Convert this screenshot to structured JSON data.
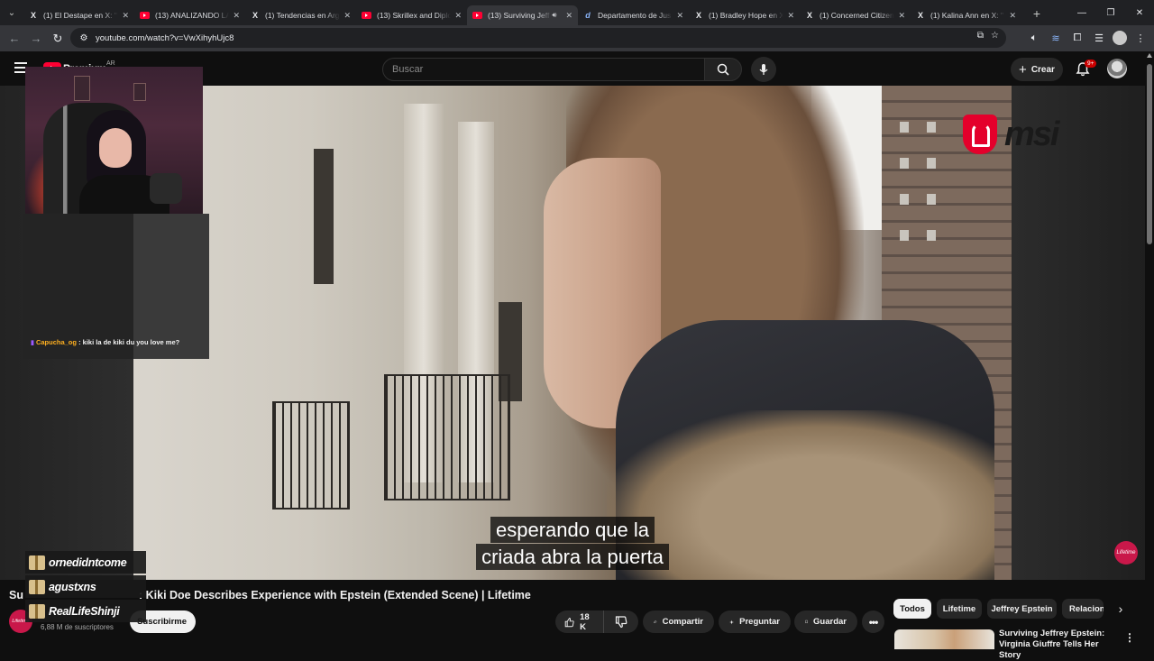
{
  "browser": {
    "tabs": [
      {
        "title": "(1) El Destape en X: \"",
        "favicon": "x-logo"
      },
      {
        "title": "(13) ANALIZANDO LA",
        "favicon": "youtube-logo"
      },
      {
        "title": "(1) Tendencias en Arg",
        "favicon": "x-logo"
      },
      {
        "title": "(13) Skrillex and Diplo",
        "favicon": "youtube-logo"
      },
      {
        "title": "(13) Surviving Jeff",
        "favicon": "youtube-logo",
        "active": true
      },
      {
        "title": "Departamento de Jus",
        "favicon": "doj-logo"
      },
      {
        "title": "(1) Bradley Hope en X",
        "favicon": "x-logo"
      },
      {
        "title": "(1) Concerned Citizen",
        "favicon": "x-logo"
      },
      {
        "title": "(1) Kalina Ann en X: \"",
        "favicon": "x-logo"
      }
    ],
    "url": "youtube.com/watch?v=VwXihyhUjc8"
  },
  "youtube": {
    "logo_text": "Premium",
    "country": "AR",
    "search_placeholder": "Buscar",
    "create_label": "Crear",
    "notifications_badge": "9+"
  },
  "stream_overlay": {
    "chat_user": "Capucha_og",
    "chat_message": "kiki la de kiki du you love me?",
    "gift_names": [
      "ornedidntcome",
      "agustxns",
      "RealLifeShinji"
    ]
  },
  "video": {
    "subtitle_lines": [
      "esperando que la",
      "criada abra la puerta"
    ],
    "sponsor_logo": "msi",
    "watermark": "Lifetime",
    "title_start": "Su",
    "title_visible": ": Kiki Doe Describes Experience with Epstein (Extended Scene) | Lifetime",
    "channel_avatar_text": "Lifetime",
    "subscribers": "6,88 M de suscriptores",
    "subscribe_label": "Suscribirme",
    "likes": "18 K",
    "share_label": "Compartir",
    "ask_label": "Preguntar",
    "save_label": "Guardar"
  },
  "sidebar": {
    "chips": [
      "Todos",
      "Lifetime",
      "Jeffrey Epstein",
      "Relacionado"
    ],
    "recommendation_title": "Surviving Jeffrey Epstein: Virginia Giuffre Tells Her Story"
  },
  "colors": {
    "youtube_red": "#ff0033",
    "lifetime_pink": "#c9184a",
    "msi_red": "#e4002b",
    "chat_user": "#ffb020"
  }
}
